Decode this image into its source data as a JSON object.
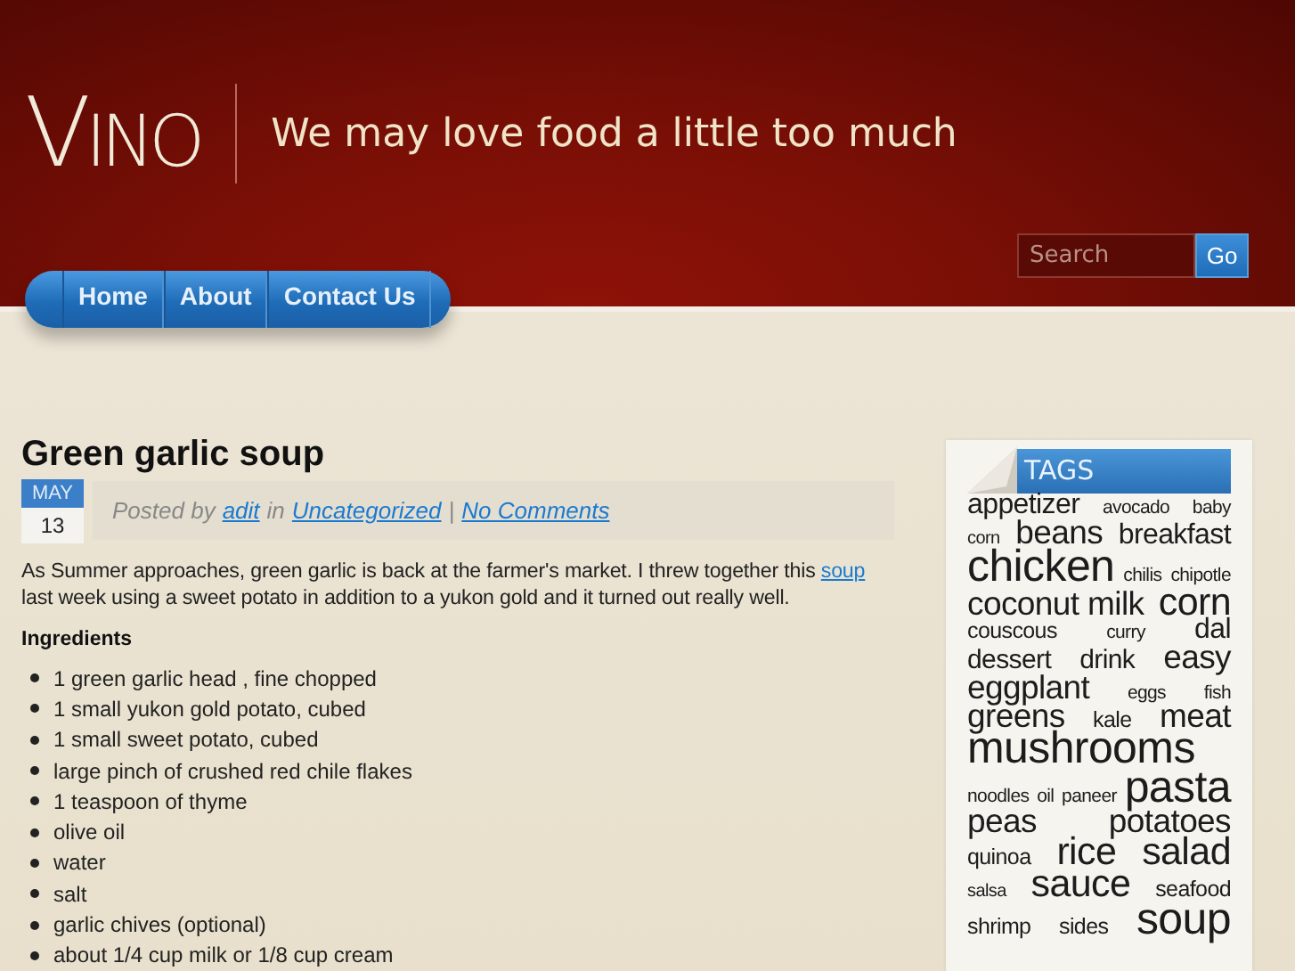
{
  "header": {
    "logo": "VINO",
    "tagline": "We may love food a little too much"
  },
  "search": {
    "placeholder": "Search",
    "button": "Go"
  },
  "nav": [
    {
      "label": "Home"
    },
    {
      "label": "About"
    },
    {
      "label": "Contact Us"
    }
  ],
  "post": {
    "title": "Green garlic soup",
    "date": {
      "month": "MAY",
      "day": "13"
    },
    "meta": {
      "prefix": "Posted by",
      "author": "adit",
      "in": "in",
      "category": "Uncategorized",
      "separator": "|",
      "comments": "No Comments"
    },
    "intro": {
      "before": "As Summer approaches, green garlic is back at the farmer's market.  I threw together this",
      "link": "soup",
      "after": "last week using a sweet potato in addition to a yukon gold and it turned out really well."
    },
    "ingredients_heading": "Ingredients",
    "ingredients": [
      "1 green garlic head , fine chopped",
      "1 small yukon gold potato, cubed",
      "1 small sweet potato, cubed",
      "large pinch of crushed red chile flakes",
      "1 teaspoon of thyme",
      "olive oil",
      "water",
      "salt",
      "garlic chives (optional)",
      "about 1/4 cup milk or 1/8 cup cream"
    ]
  },
  "tags": {
    "title": "TAGS",
    "lines": [
      [
        {
          "label": "appetizer",
          "kind": "m"
        },
        {
          "label": "avocado",
          "kind": "xs"
        },
        {
          "label": "baby",
          "kind": "xs"
        }
      ],
      [
        {
          "label": "corn",
          "kind": "xxs"
        },
        {
          "label": "beans",
          "kind": "l"
        },
        {
          "label": "breakfast",
          "kind": "m"
        }
      ],
      [
        {
          "label": "chicken",
          "kind": "xxl"
        },
        {
          "label": "chilis",
          "kind": "xs"
        },
        {
          "label": "chipotle",
          "kind": "xs"
        }
      ],
      [
        {
          "label": "coconut milk",
          "kind": "l"
        },
        {
          "label": "corn",
          "kind": "xl"
        }
      ],
      [
        {
          "label": "couscous",
          "kind": "s"
        },
        {
          "label": "curry",
          "kind": "xs"
        },
        {
          "label": "dal",
          "kind": "m"
        }
      ],
      [
        {
          "label": "dessert",
          "kind": "ms"
        },
        {
          "label": "drink",
          "kind": "ms"
        },
        {
          "label": "easy",
          "kind": "l"
        }
      ],
      [
        {
          "label": "eggplant",
          "kind": "l"
        },
        {
          "label": "eggs",
          "kind": "xs"
        },
        {
          "label": "fish",
          "kind": "xs"
        }
      ],
      [
        {
          "label": "greens",
          "kind": "l"
        },
        {
          "label": "kale",
          "kind": "s"
        },
        {
          "label": "meat",
          "kind": "l"
        }
      ],
      [
        {
          "label": "mushrooms",
          "kind": "xxl"
        }
      ],
      [
        {
          "label": "noodles",
          "kind": "xs"
        },
        {
          "label": "oil",
          "kind": "xs"
        },
        {
          "label": "paneer",
          "kind": "xs"
        },
        {
          "label": "pasta",
          "kind": "xxl"
        }
      ],
      [
        {
          "label": "peas",
          "kind": "l"
        },
        {
          "label": "potatoes",
          "kind": "l"
        }
      ],
      [
        {
          "label": "quinoa",
          "kind": "s"
        },
        {
          "label": "rice",
          "kind": "xl"
        },
        {
          "label": "salad",
          "kind": "xl"
        }
      ],
      [
        {
          "label": "salsa",
          "kind": "xxs"
        },
        {
          "label": "sauce",
          "kind": "xl"
        },
        {
          "label": "seafood",
          "kind": "s"
        }
      ],
      [
        {
          "label": "shrimp",
          "kind": "s"
        },
        {
          "label": "sides",
          "kind": "s"
        },
        {
          "label": "soup",
          "kind": "xxl"
        }
      ]
    ]
  }
}
